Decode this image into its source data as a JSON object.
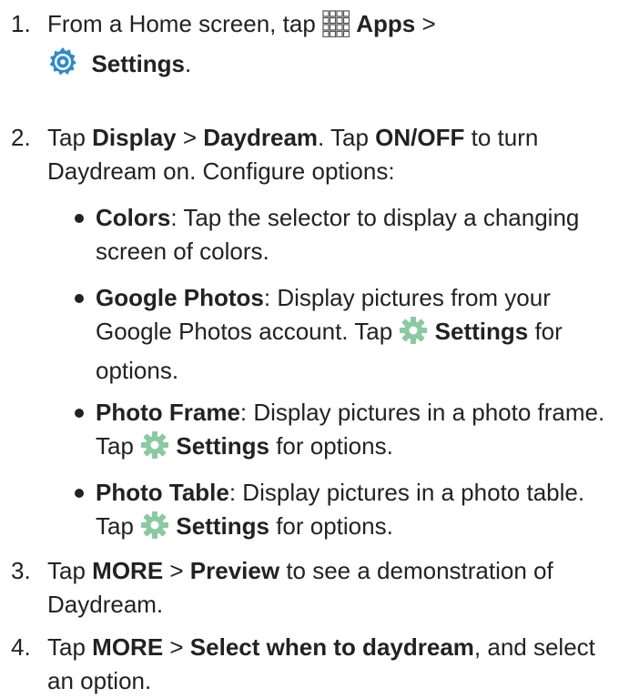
{
  "steps": [
    {
      "number": "1.",
      "parts": [
        "From a Home screen, tap ",
        "Apps",
        " >",
        "Settings",
        "."
      ]
    },
    {
      "number": "2.",
      "parts": [
        "Tap ",
        "Display",
        " > ",
        "Daydream",
        ". Tap ",
        "ON/OFF",
        " to turn Daydream on. Configure options:"
      ],
      "bullets": [
        {
          "parts": [
            "Colors",
            ": Tap the selector to display a changing screen of colors."
          ]
        },
        {
          "parts": [
            "Google Photos",
            ": Display pictures from your Google Photos account. Tap ",
            "Settings",
            " for options."
          ]
        },
        {
          "parts": [
            "Photo Frame",
            ": Display pictures in a photo frame. Tap ",
            "Settings",
            " for options."
          ]
        },
        {
          "parts": [
            "Photo Table",
            ": Display pictures in a photo table. Tap ",
            "Settings",
            " for options."
          ]
        }
      ]
    },
    {
      "number": "3.",
      "parts": [
        "Tap ",
        "MORE",
        " > ",
        "Preview",
        " to see a demonstration of Daydream."
      ]
    },
    {
      "number": "4.",
      "parts": [
        "Tap ",
        "MORE",
        " > ",
        "Select when to daydream",
        ", and select an option."
      ]
    }
  ],
  "icons": {
    "apps": "apps-grid-icon",
    "settings_app": "settings-app-icon",
    "settings_gear": "settings-gear-icon"
  },
  "colors": {
    "text": "#222222",
    "settings_app_blue": "#2c8ad0",
    "gear_green": "#8bc9a0"
  }
}
